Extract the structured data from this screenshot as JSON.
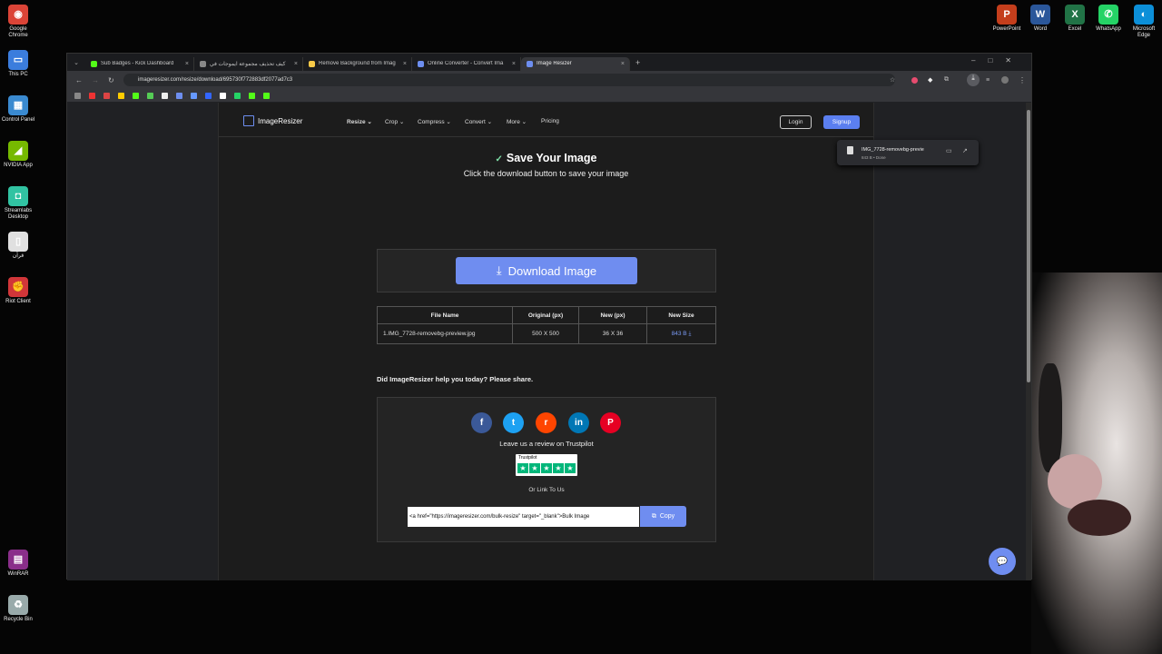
{
  "desktop_icons": [
    {
      "label": "Google Chrome",
      "glyph": "◉",
      "color": "#db4437"
    },
    {
      "label": "This PC",
      "glyph": "▭",
      "color": "#3b7ddd"
    },
    {
      "label": "Control Panel",
      "glyph": "▦",
      "color": "#3a8ad0"
    },
    {
      "label": "NVIDIA App",
      "glyph": "◢",
      "color": "#76b900"
    },
    {
      "label": "Streamlabs Desktop",
      "glyph": "◘",
      "color": "#31c3a2"
    },
    {
      "label": "قرآن",
      "glyph": "▯",
      "color": "#e0e0e0"
    },
    {
      "label": "Riot Client",
      "glyph": "✊",
      "color": "#d13639"
    },
    {
      "label": "WinRAR",
      "glyph": "▤",
      "color": "#8a2e8a"
    },
    {
      "label": "Recycle Bin",
      "glyph": "♻",
      "color": "#9aa"
    },
    {
      "label": "PowerPoint",
      "glyph": "P",
      "color": "#c43e1c"
    },
    {
      "label": "Word",
      "glyph": "W",
      "color": "#2b579a"
    },
    {
      "label": "Excel",
      "glyph": "X",
      "color": "#217346"
    },
    {
      "label": "WhatsApp",
      "glyph": "✆",
      "color": "#25d366"
    },
    {
      "label": "Microsoft Edge",
      "glyph": "◐",
      "color": "#0c8fd8"
    }
  ],
  "tabs": [
    {
      "title": "Sub Badges - Kick Dashboard",
      "color": "#53fc18"
    },
    {
      "title": "كيف تحذيف مجموعة ايموجات في",
      "color": "#888"
    },
    {
      "title": "Remove Background from Imag",
      "color": "#f7c948"
    },
    {
      "title": "Online Converter - Convert Ima",
      "color": "#6d8ef0"
    },
    {
      "title": "Image Resizer",
      "color": "#6d8ef0"
    }
  ],
  "new_tab": "+",
  "url": "imageresizer.com/resize/download/695730f772883df2077ad7c3",
  "download_panel": {
    "file": "IMG_7728-removebg-previe",
    "meta": "843 B • Done"
  },
  "site": {
    "brand": "ImageResizer",
    "nav": [
      "Resize ⌄",
      "Crop ⌄",
      "Compress ⌄",
      "Convert ⌄",
      "More ⌄",
      "Pricing"
    ],
    "login": "Login",
    "signup": "Signup"
  },
  "heading": {
    "title": "Save Your Image",
    "check": "✓",
    "subtitle": "Click the download button to save your image"
  },
  "download_button": {
    "icon": "⤓",
    "label": "Download Image"
  },
  "file_table": {
    "headers": [
      "File Name",
      "Original (px)",
      "New (px)",
      "New Size"
    ],
    "row": [
      "1.IMG_7728-removebg-preview.jpg",
      "500 X 500",
      "36 X 36",
      "843 B ⤓"
    ]
  },
  "share_question": "Did ImageResizer help you today? Please share.",
  "social": [
    {
      "glyph": "f",
      "color": "#3b5998"
    },
    {
      "glyph": "t",
      "color": "#1da1f2"
    },
    {
      "glyph": "r",
      "color": "#ff4500"
    },
    {
      "glyph": "in",
      "color": "#0077b5"
    },
    {
      "glyph": "P",
      "color": "#e60023"
    }
  ],
  "review_text": "Leave us a review on Trustpilot",
  "trustpilot": {
    "label": "Trustpilot",
    "stars": [
      "★",
      "★",
      "★",
      "★",
      "★"
    ]
  },
  "or_link": "Or Link To Us",
  "embed_code": "<a href=\"https://imageresizer.com/bulk-resize\" target=\"_blank\">Bulk Image",
  "copy_label": "Copy",
  "chat_icon": "💬"
}
